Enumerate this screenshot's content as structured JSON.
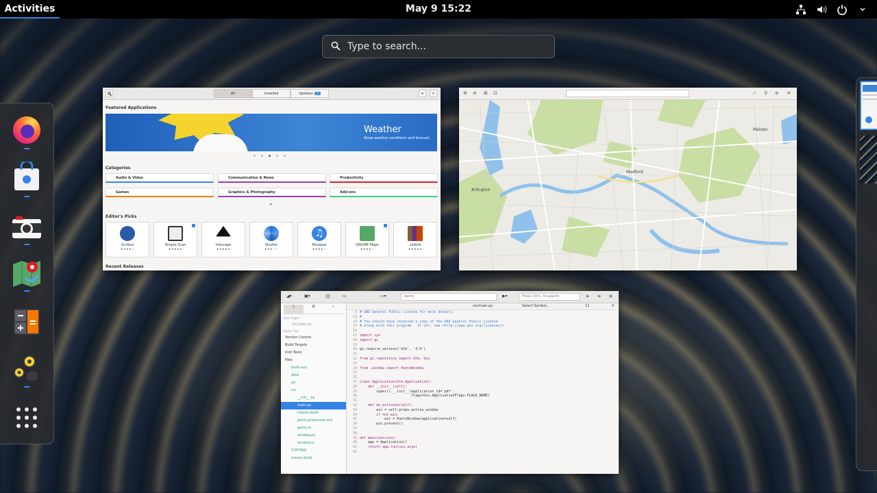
{
  "topbar": {
    "activities": "Activities",
    "clock": "May 9  15:22"
  },
  "search": {
    "placeholder": "Type to search..."
  },
  "dash": {
    "apps": [
      "Firefox",
      "Software",
      "Cheese",
      "Maps",
      "Calculator",
      "Builder",
      "Show Applications"
    ]
  },
  "software": {
    "tabs": [
      "All",
      "Installed",
      "Updates"
    ],
    "updates_count": "11",
    "featured_title": "Featured Applications",
    "banner_title": "Weather",
    "banner_subtitle": "Show weather conditions and forecast",
    "categories_title": "Categories",
    "categories": [
      "Audio & Video",
      "Communication & News",
      "Productivity",
      "Games",
      "Graphics & Photography",
      "Add-ons"
    ],
    "editors_picks_title": "Editor's Picks",
    "picks": [
      "Scribus",
      "Simple Scan",
      "Inkscape",
      "Shutter",
      "Musique",
      "GNOME Maps",
      "calibre"
    ],
    "recent_title": "Recent Releases"
  },
  "maps": {
    "labels": [
      "Arlington",
      "Medford",
      "Malden"
    ]
  },
  "builder": {
    "title": "src/main.py",
    "project_search": "Press Ctrl+. to search",
    "branch": "pants",
    "symbol": "Select Symbol...",
    "line": "11",
    "open_pages_title": "Open Pages",
    "open_page": "src/main.py",
    "project_tree_title": "Project Tree",
    "tree": [
      "Version Control",
      "Build Targets",
      "Unit Tests",
      "Files",
      "build-aux",
      "data",
      "po",
      "src",
      "__init__.py",
      "main.py",
      "meson.build",
      "pants.gresource.xml",
      "pants.in",
      "window.py",
      "window.ui",
      "COPYING",
      "meson.build"
    ],
    "gutter": [
      "6",
      "13",
      "14",
      "15",
      "16",
      "17",
      "18",
      "19",
      "20",
      "21",
      "22",
      "23",
      "24",
      "25",
      "26",
      "27",
      "28",
      "29",
      "30",
      "31",
      "32",
      "33",
      "34",
      "35",
      "36",
      "37",
      "38",
      "39",
      "40",
      "41",
      "42"
    ],
    "code": [
      "# GNU General Public License for more details.",
      "#",
      "# You should have received a copy of the GNU General Public License",
      "# along with this program.  If not, see <http://www.gnu.org/licenses/>.",
      "",
      "import sys",
      "import gi",
      "",
      "gi.require_version('Gtk', '3.0')",
      "",
      "from gi.repository import Gtk, Gio",
      "",
      "from .window import PantsWindow",
      "",
      "",
      "class Application(Gtk.Application):",
      "    def __init__(self):",
      "        super().__init__(application_id='pdf',",
      "                         flags=Gio.ApplicationFlags.FLAGS_NONE)",
      "",
      "    def do_activate(self):",
      "        win = self.props.active_window",
      "        if not win:",
      "            win = PantsWindow(application=self)",
      "        win.present()",
      "",
      "",
      "def main(version):",
      "    app = Application()",
      "    return app.run(sys.argv)"
    ]
  }
}
